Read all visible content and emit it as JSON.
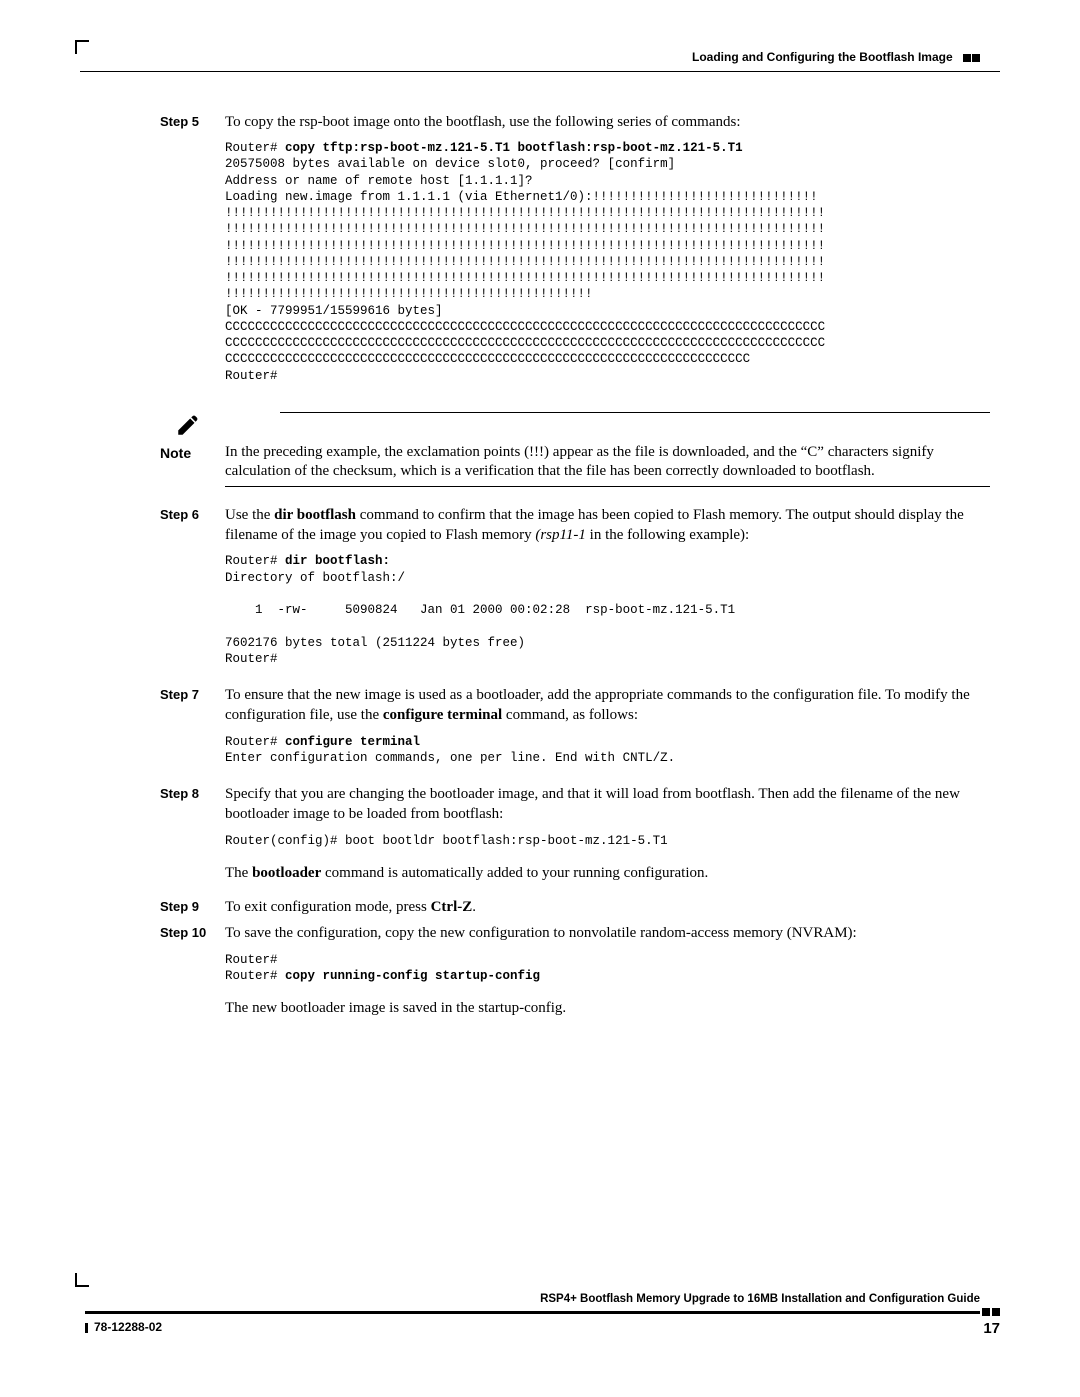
{
  "header": {
    "title": "Loading and Configuring the Bootflash Image"
  },
  "steps": {
    "s5": {
      "label": "Step 5",
      "text": "To copy the rsp-boot image onto the bootflash, use the following series of commands:",
      "term_prefix": "Router# ",
      "term_cmd": "copy tftp:rsp-boot-mz.121-5.T1 bootflash:rsp-boot-mz.121-5.T1",
      "term_body": "20575008 bytes available on device slot0, proceed? [confirm]\nAddress or name of remote host [1.1.1.1]?\nLoading new.image from 1.1.1.1 (via Ethernet1/0):!!!!!!!!!!!!!!!!!!!!!!!!!!!!!!\n!!!!!!!!!!!!!!!!!!!!!!!!!!!!!!!!!!!!!!!!!!!!!!!!!!!!!!!!!!!!!!!!!!!!!!!!!!!!!!!!\n!!!!!!!!!!!!!!!!!!!!!!!!!!!!!!!!!!!!!!!!!!!!!!!!!!!!!!!!!!!!!!!!!!!!!!!!!!!!!!!!\n!!!!!!!!!!!!!!!!!!!!!!!!!!!!!!!!!!!!!!!!!!!!!!!!!!!!!!!!!!!!!!!!!!!!!!!!!!!!!!!!\n!!!!!!!!!!!!!!!!!!!!!!!!!!!!!!!!!!!!!!!!!!!!!!!!!!!!!!!!!!!!!!!!!!!!!!!!!!!!!!!!\n!!!!!!!!!!!!!!!!!!!!!!!!!!!!!!!!!!!!!!!!!!!!!!!!!!!!!!!!!!!!!!!!!!!!!!!!!!!!!!!!\n!!!!!!!!!!!!!!!!!!!!!!!!!!!!!!!!!!!!!!!!!!!!!!!!!\n[OK - 7799951/15599616 bytes]\nCCCCCCCCCCCCCCCCCCCCCCCCCCCCCCCCCCCCCCCCCCCCCCCCCCCCCCCCCCCCCCCCCCCCCCCCCCCCCCCC\nCCCCCCCCCCCCCCCCCCCCCCCCCCCCCCCCCCCCCCCCCCCCCCCCCCCCCCCCCCCCCCCCCCCCCCCCCCCCCCCC\nCCCCCCCCCCCCCCCCCCCCCCCCCCCCCCCCCCCCCCCCCCCCCCCCCCCCCCCCCCCCCCCCCCCCCC\nRouter#"
    },
    "note": {
      "label": "Note",
      "text": "In the preceding example, the exclamation points (!!!) appear as the file is downloaded, and the “C” characters signify calculation of the checksum, which is a verification that the file has been correctly downloaded to bootflash."
    },
    "s6": {
      "label": "Step 6",
      "text_a": "Use the ",
      "text_b_bold": "dir bootflash",
      "text_c": " command to confirm that the image has been copied to Flash memory. The output should display the filename of the image you copied to Flash memory ",
      "text_d_italic": "(rsp11-1",
      "text_e": " in the following example):",
      "term_prefix": "Router# ",
      "term_cmd": "dir bootflash:",
      "term_body": "Directory of bootflash:/\n\n    1  -rw-     5090824   Jan 01 2000 00:02:28  rsp-boot-mz.121-5.T1\n\n7602176 bytes total (2511224 bytes free)\nRouter#"
    },
    "s7": {
      "label": "Step 7",
      "text_a": "To ensure that the new image is used as a bootloader, add the appropriate commands to the configuration file. To modify the configuration file, use the ",
      "text_b_bold": "configure terminal",
      "text_c": " command, as follows:",
      "term_prefix": "Router# ",
      "term_cmd": "configure terminal",
      "term_body": "Enter configuration commands, one per line. End with CNTL/Z."
    },
    "s8": {
      "label": "Step 8",
      "text": "Specify that you are changing the bootloader image, and that it will load from bootflash. Then add the filename of the new bootloader image to be loaded from bootflash:",
      "term_body": "Router(config)# boot bootldr bootflash:rsp-boot-mz.121-5.T1",
      "after_a": "The ",
      "after_b_bold": "bootloader",
      "after_c": " command is automatically added to your running configuration."
    },
    "s9": {
      "label": "Step 9",
      "text_a": "To exit configuration mode, press ",
      "text_b_bold": "Ctrl-Z",
      "text_c": "."
    },
    "s10": {
      "label": "Step 10",
      "text": "To save the configuration, copy the new configuration to nonvolatile random-access memory (NVRAM):",
      "term_l1": "Router#",
      "term_l2_prefix": "Router# ",
      "term_l2_cmd": "copy running-config startup-config",
      "after": "The new bootloader image is saved in the startup-config."
    }
  },
  "footer": {
    "title": "RSP4+ Bootflash Memory Upgrade to 16MB Installation and Configuration Guide",
    "docnum": "78-12288-02",
    "pagenum": "17"
  }
}
